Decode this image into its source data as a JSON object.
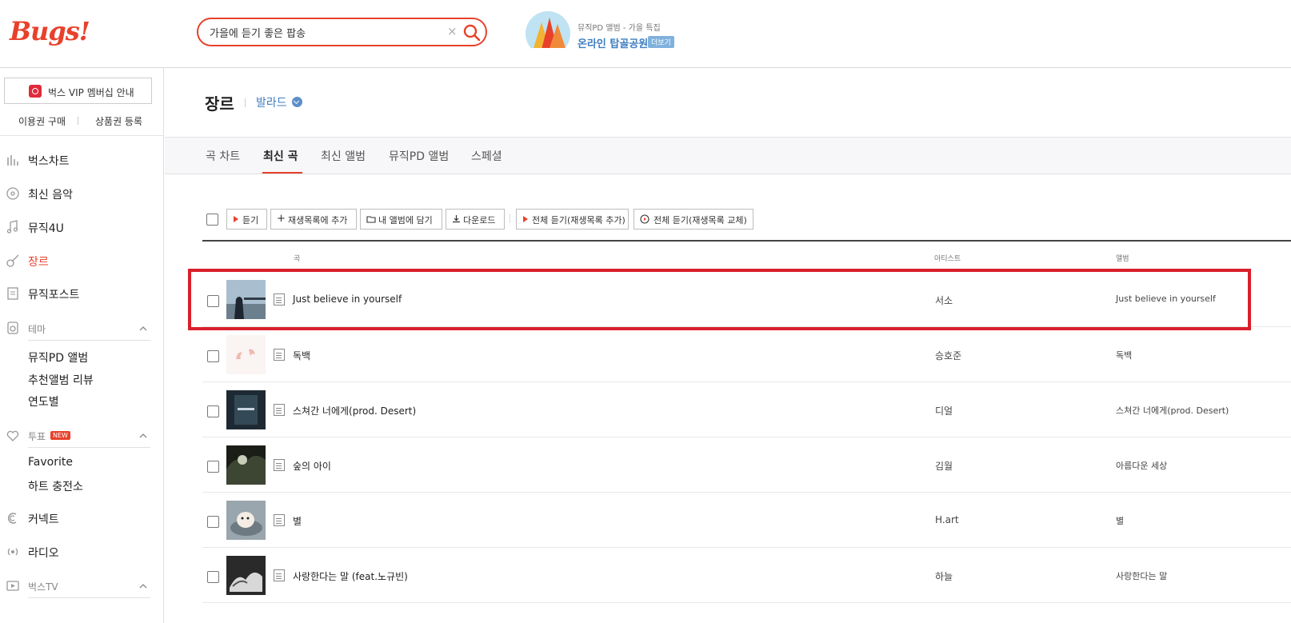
{
  "header": {
    "logo": "Bugs!",
    "search": {
      "value": "가을에 듣기 좋은 팝송",
      "clear_icon": "×"
    },
    "promo": {
      "subtitle": "뮤직PD 앨범 - 가을 특집",
      "title": "온라인 탑골공원",
      "more": "더보기"
    }
  },
  "sidebar": {
    "vip_button": "벅스 VIP 멤버십 안내",
    "links": [
      "이용권 구매",
      "상품권 등록"
    ],
    "nav": [
      {
        "label": "벅스차트",
        "icon": "chart-bars-icon"
      },
      {
        "label": "최신 음악",
        "icon": "disc-new-icon"
      },
      {
        "label": "뮤직4U",
        "icon": "music-note-icon"
      },
      {
        "label": "장르",
        "icon": "guitar-icon",
        "active": true
      },
      {
        "label": "뮤직포스트",
        "icon": "post-icon"
      }
    ],
    "theme": {
      "label": "테마",
      "items": [
        "뮤직PD 앨범",
        "추천앨범 리뷰",
        "연도별"
      ]
    },
    "vote": {
      "label": "투표",
      "badge": "NEW",
      "items": [
        "Favorite",
        "하트 충전소"
      ]
    },
    "connect": "커넥트",
    "radio": "라디오",
    "bugstv": "벅스TV"
  },
  "page": {
    "title": "장르",
    "genre": "발라드"
  },
  "tabs": [
    "곡 차트",
    "최신 곡",
    "최신 앨범",
    "뮤직PD 앨범",
    "스페셜"
  ],
  "active_tab": "최신 곡",
  "toolbar": {
    "play": "듣기",
    "add_playlist": "재생목록에 추가",
    "add_album": "내 앨범에 담기",
    "download": "다운로드",
    "play_all_add": "전체 듣기(재생목록 추가)",
    "play_all_replace": "전체 듣기(재생목록 교체)"
  },
  "table": {
    "headers": {
      "song": "곡",
      "artist": "아티스트",
      "album": "앨범"
    },
    "rows": [
      {
        "title": "Just believe in yourself",
        "artist": "서소",
        "album": "Just believe in yourself"
      },
      {
        "title": "독백",
        "artist": "승호준",
        "album": "독백"
      },
      {
        "title": "스쳐간 너에게(prod. Desert)",
        "artist": "디얼",
        "album": "스쳐간 너에게(prod. Desert)"
      },
      {
        "title": "숲의 아이",
        "artist": "김월",
        "album": "아름다운 세상"
      },
      {
        "title": "별",
        "artist": "H.art",
        "album": "별"
      },
      {
        "title": "사랑한다는 말 (feat.노규빈)",
        "artist": "하늘",
        "album": "사랑한다는 말"
      }
    ]
  },
  "colors": {
    "brand": "#e8412b",
    "link": "#3f7ec2",
    "highlight": "#d91f2a"
  }
}
